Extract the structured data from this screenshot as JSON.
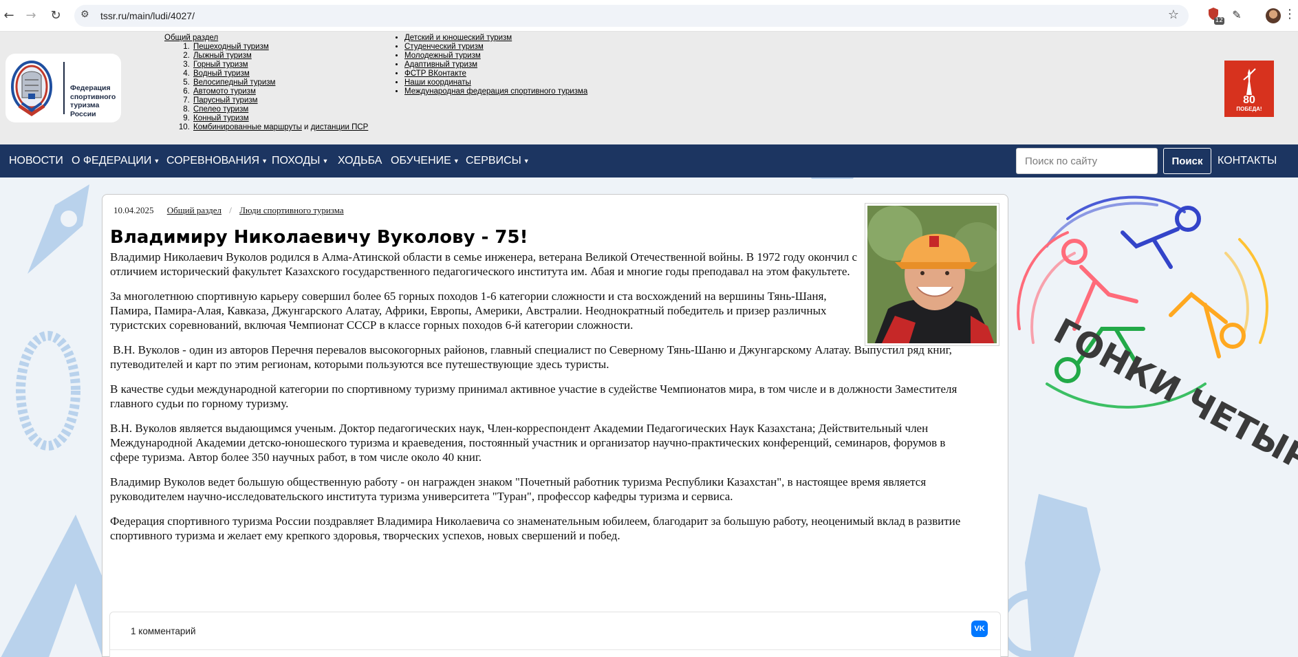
{
  "browser": {
    "url": "tssr.ru/main/ludi/4027/",
    "extension_badge": "12"
  },
  "header": {
    "logo_text": "Федерация спортивного туризма России",
    "general_section": "Общий раздел",
    "tourism_types": [
      "Пешеходный туризм",
      "Лыжный туризм",
      "Горный туризм",
      "Водный туризм",
      "Велосипедный туризм",
      "Автомото туризм",
      "Парусный туризм",
      "Спелео туризм",
      "Конный туризм"
    ],
    "tourism_type_10": {
      "link1": "Комбинированные маршруты",
      "joiner": " и ",
      "link2": "дистанции ПСР"
    },
    "right_links": [
      "Детский и юношеский туризм",
      "Студенческий туризм",
      "Молодежный туризм",
      "Адаптивный туризм",
      "ФСТР ВКонтакте",
      "Наши координаты",
      "Международная федерация спортивного туризма"
    ],
    "victory_badge": {
      "number": "80",
      "text": "ПОБЕДА!"
    }
  },
  "navbar": {
    "items": [
      "НОВОСТИ",
      "О ФЕДЕРАЦИИ",
      "СОРЕВНОВАНИЯ",
      "ПОХОДЫ",
      "ХОДЬБА",
      "ОБУЧЕНИЕ",
      "СЕРВИСЫ"
    ],
    "search_placeholder": "Поиск по сайту",
    "search_button": "Поиск",
    "contacts": "КОНТАКТЫ"
  },
  "side_banner": {
    "text": "ГОНКИ ЧЕТЫРЕХ"
  },
  "article": {
    "date": "10.04.2025",
    "breadcrumbs": [
      "Общий раздел",
      "Люди спортивного туризма"
    ],
    "title": "Владимиру Николаевичу Вуколову - 75!",
    "paragraphs": [
      "Владимир Николаевич Вуколов родился в Алма-Атинской области в семье инженера, ветерана Великой Отечественной войны. В 1972 году окончил с отличием исторический факультет Казахского государственного педагогического института им. Абая и многие годы преподавал на этом факультете.",
      "За многолетнюю спортивную карьеру совершил более 65 горных походов 1-6 категории сложности и ста восхождений на вершины Тянь-Шаня, Памира, Памира-Алая, Кавказа, Джунгарского Алатау, Африки, Европы, Америки, Австралии. Неоднократный победитель и призер различных туристских соревнований, включая  Чемпионат СССР в классе горных походов 6-й категории сложности.",
      " В.Н. Вуколов - один из авторов Перечня перевалов высокогорных районов, главный специалист по Северному Тянь-Шаню и Джунгарскому Алатау. Выпустил ряд книг, путеводителей и карт по этим регионам, которыми пользуются все путешествующие здесь туристы.",
      "В качестве судьи международной категории по спортивному туризму принимал активное участие в судействе Чемпионатов мира, в том числе и в должности Заместителя главного судьи по горному туризму.",
      "В.Н. Вуколов является выдающимся ученым. Доктор педагогических наук, Член-корреспондент Академии Педагогических Наук Казахстана; Действительный член Международной Академии детско-юношеского туризма и краеведения, постоянный участник и организатор научно-практических конференций, семинаров, форумов в сфере туризма. Автор более 350 научных работ, в том числе около 40 книг.",
      "Владимир Вуколов ведет большую общественную работу - он награжден знаком \"Почетный работник туризма Республики Казахстан\", в настоящее время является руководителем научно-исследовательского института туризма университета \"Туран\", профессор кафедры туризма и сервиса.",
      "Федерация спортивного туризма России  поздравляет Владимира Николаевича со знаменательным  юбилеем, благодарит за большую работу, неоценимый вклад  в  развитие  спортивного туризма и желает ему крепкого здоровья, творческих успехов, новых свершений и побед."
    ]
  },
  "comments": {
    "count_label": "1 комментарий",
    "vk_label": "VK"
  }
}
